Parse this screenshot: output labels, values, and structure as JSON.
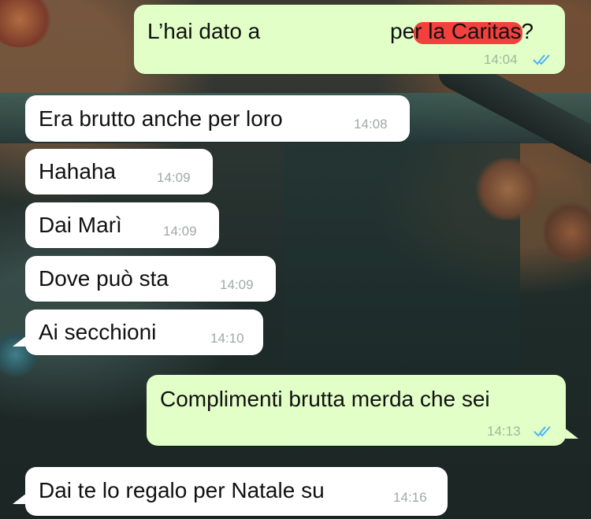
{
  "colors": {
    "incoming_bubble": "#ffffff",
    "outgoing_bubble": "#e1ffc7",
    "read_ticks": "#4fb3f6",
    "redaction": "#f2403c"
  },
  "icons": {
    "read_receipt": "double-check-icon"
  },
  "messages": [
    {
      "direction": "outgoing",
      "text_before": "L’hai dato a",
      "text_after": "per la Caritas?",
      "redacted": true,
      "time": "14:04",
      "status": "read"
    },
    {
      "direction": "incoming",
      "text": "Era brutto anche per loro",
      "time": "14:08"
    },
    {
      "direction": "incoming",
      "text": "Hahaha",
      "time": "14:09"
    },
    {
      "direction": "incoming",
      "text": "Dai Marì",
      "time": "14:09"
    },
    {
      "direction": "incoming",
      "text": "Dove può sta",
      "time": "14:09"
    },
    {
      "direction": "incoming",
      "text": "Ai secchioni",
      "time": "14:10"
    },
    {
      "direction": "outgoing",
      "text": "Complimenti brutta merda che sei",
      "time": "14:13",
      "status": "read"
    },
    {
      "direction": "incoming",
      "text": "Dai te lo regalo per Natale su",
      "time": "14:16"
    }
  ]
}
